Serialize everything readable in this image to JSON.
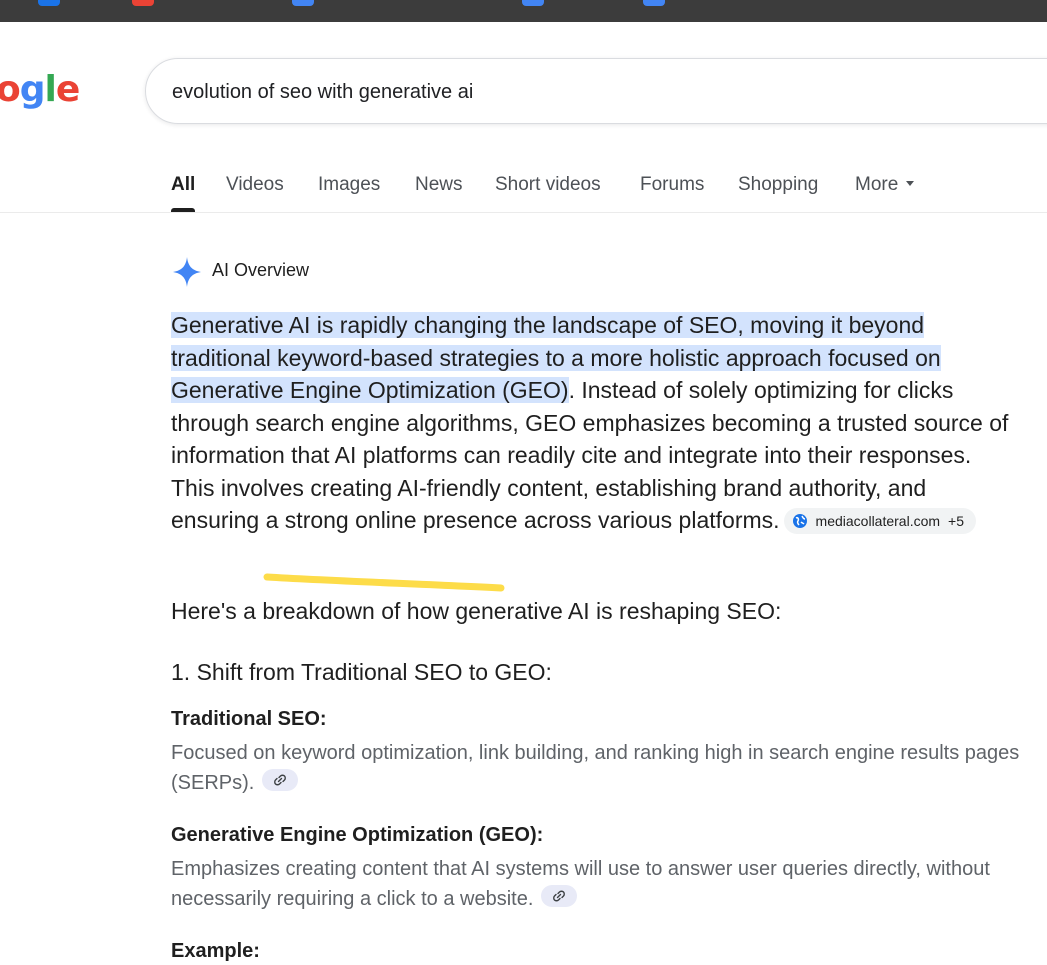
{
  "logo": {
    "text": "ogle",
    "letters": [
      {
        "ch": "o",
        "color": "#ea4335"
      },
      {
        "ch": "g",
        "color": "#4285f4"
      },
      {
        "ch": "l",
        "color": "#34a853"
      },
      {
        "ch": "e",
        "color": "#ea4335"
      }
    ]
  },
  "search": {
    "query": "evolution of seo with generative ai"
  },
  "tabs": [
    {
      "label": "All",
      "active": true
    },
    {
      "label": "Videos"
    },
    {
      "label": "Images"
    },
    {
      "label": "News"
    },
    {
      "label": "Short videos"
    },
    {
      "label": "Forums"
    },
    {
      "label": "Shopping"
    },
    {
      "label": "More"
    }
  ],
  "ai_overview": {
    "title": "AI Overview",
    "highlighted_text": " Generative AI is rapidly changing the landscape of SEO, moving it beyond traditional keyword-based strategies to a more holistic approach focused on Generative Engine Optimization (GEO)",
    "body_text": ". Instead of solely optimizing for clicks through search engine algorithms, GEO emphasizes becoming a trusted source of information that AI platforms can readily cite and integrate into their responses. This involves creating AI-friendly content, establishing brand authority, and ensuring a strong online presence across various platforms.",
    "source_chip": {
      "domain": "mediacollateral.com",
      "more": "+5"
    },
    "breakdown_intro": "Here's a breakdown of how generative AI is reshaping SEO:",
    "section1_heading": "1. Shift from Traditional SEO to GEO:",
    "traditional": {
      "heading": "Traditional SEO:",
      "text": "Focused on keyword optimization, link building, and ranking high in search engine results pages (SERPs)."
    },
    "geo": {
      "heading": "Generative Engine Optimization (GEO):",
      "text": "Emphasizes creating content that AI systems will use to answer user queries directly, without necessarily requiring a click to a website."
    },
    "example_heading": "Example:"
  },
  "colors": {
    "highlight": "#d3e3fd",
    "annotation_underline": "#fdd835",
    "ai_spark": "#4285f4",
    "muted_text": "#5f6368"
  }
}
